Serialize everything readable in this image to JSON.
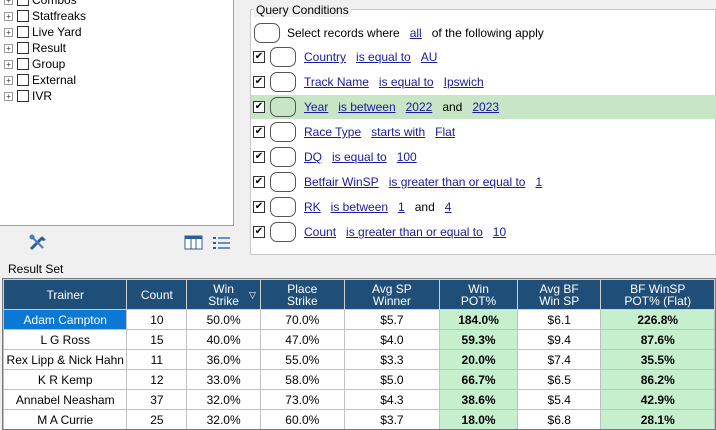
{
  "tree": {
    "items": [
      {
        "label": "Combos"
      },
      {
        "label": "Statfreaks"
      },
      {
        "label": "Live Yard"
      },
      {
        "label": "Result"
      },
      {
        "label": "Group"
      },
      {
        "label": "External"
      },
      {
        "label": "IVR"
      }
    ]
  },
  "toolbar": {
    "icons": [
      "tools-icon",
      "columns-icon",
      "list-icon"
    ]
  },
  "query": {
    "title": "Query Conditions",
    "select_prefix": "Select records where",
    "select_mode": "all",
    "select_suffix": "of the following apply",
    "conditions": [
      {
        "field": "Country",
        "op": "is equal to",
        "v1": "AU",
        "and": "",
        "v2": "",
        "checked": true,
        "highlight": false
      },
      {
        "field": "Track Name",
        "op": "is equal to",
        "v1": "Ipswich",
        "and": "",
        "v2": "",
        "checked": true,
        "highlight": false
      },
      {
        "field": "Year",
        "op": "is between",
        "v1": "2022",
        "and": "and",
        "v2": "2023",
        "checked": true,
        "highlight": true
      },
      {
        "field": "Race Type",
        "op": "starts with",
        "v1": "Flat",
        "and": "",
        "v2": "",
        "checked": true,
        "highlight": false
      },
      {
        "field": "DQ",
        "op": "is equal to",
        "v1": "100",
        "and": "",
        "v2": "",
        "checked": true,
        "highlight": false
      },
      {
        "field": "Betfair WinSP",
        "op": "is greater than or equal to",
        "v1": "1",
        "and": "",
        "v2": "",
        "checked": true,
        "highlight": false
      },
      {
        "field": "RK",
        "op": "is between",
        "v1": "1",
        "and": "and",
        "v2": "4",
        "checked": true,
        "highlight": false
      },
      {
        "field": "Count",
        "op": "is greater than or equal to",
        "v1": "10",
        "and": "",
        "v2": "",
        "checked": true,
        "highlight": false
      }
    ]
  },
  "results": {
    "label": "Result Set",
    "columns": [
      {
        "l1": "Trainer",
        "l2": ""
      },
      {
        "l1": "Count",
        "l2": ""
      },
      {
        "l1": "Win",
        "l2": "Strike"
      },
      {
        "l1": "Place",
        "l2": "Strike"
      },
      {
        "l1": "Avg SP",
        "l2": "Winner"
      },
      {
        "l1": "Win",
        "l2": "POT%"
      },
      {
        "l1": "Avg BF",
        "l2": "Win SP"
      },
      {
        "l1": "BF WinSP",
        "l2": "POT% (Flat)"
      }
    ],
    "sort_indicator": "▽",
    "rows": [
      [
        "Adam Campton",
        "10",
        "50.0%",
        "70.0%",
        "$5.7",
        "184.0%",
        "$6.1",
        "226.8%"
      ],
      [
        "L G Ross",
        "15",
        "40.0%",
        "47.0%",
        "$4.0",
        "59.3%",
        "$9.4",
        "87.6%"
      ],
      [
        "Rex Lipp & Nick Hahn",
        "11",
        "36.0%",
        "55.0%",
        "$3.3",
        "20.0%",
        "$7.4",
        "35.5%"
      ],
      [
        "K R Kemp",
        "12",
        "33.0%",
        "58.0%",
        "$5.0",
        "66.7%",
        "$6.5",
        "86.2%"
      ],
      [
        "Annabel Neasham",
        "37",
        "32.0%",
        "73.0%",
        "$4.3",
        "38.6%",
        "$5.4",
        "42.9%"
      ],
      [
        "M A Currie",
        "25",
        "32.0%",
        "60.0%",
        "$3.7",
        "18.0%",
        "$6.8",
        "28.1%"
      ]
    ],
    "colors": {
      "header": "#1f4e79",
      "pot_green": "#c6efce",
      "selected": "#0a78d4",
      "highlight_row": "#c6e6c6"
    }
  }
}
